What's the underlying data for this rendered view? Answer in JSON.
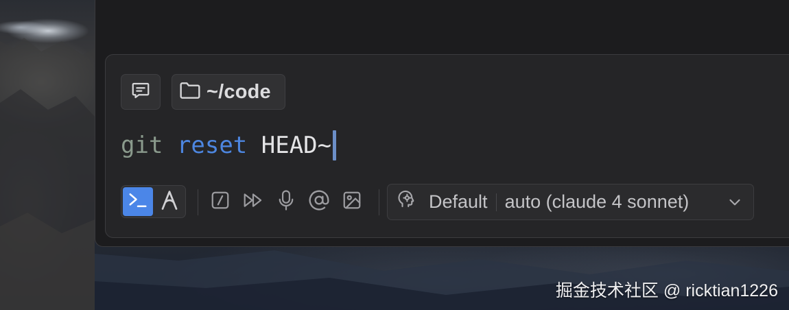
{
  "colors": {
    "accent": "#4b86e8",
    "panel_bg": "#252527",
    "window_bg": "#1c1c1e",
    "command_color": "#8a9a8c",
    "subcommand_color": "#4d86e0",
    "argument_color": "#e4e4e6",
    "cursor_color": "#6c8fc8"
  },
  "context_chips": {
    "chat_icon": "chat-bubble-icon",
    "directory_icon": "folder-icon",
    "directory_label": "~/code"
  },
  "command_input": {
    "command": "git",
    "subcommand": "reset",
    "argument": "HEAD~"
  },
  "toolbar": {
    "mode_toggle": [
      {
        "icon": "terminal-prompt-icon",
        "active": true
      },
      {
        "icon": "agent-a-icon",
        "active": false
      }
    ],
    "tools": [
      {
        "icon": "slash-command-icon"
      },
      {
        "icon": "fast-forward-icon"
      },
      {
        "icon": "microphone-icon"
      },
      {
        "icon": "at-mention-icon"
      },
      {
        "icon": "image-attach-icon"
      }
    ],
    "model_select": {
      "icon": "head-gear-icon",
      "profile": "Default",
      "model": "auto (claude 4 sonnet)",
      "chevron_icon": "chevron-down-icon"
    }
  },
  "watermark": {
    "text": "掘金技术社区 @ ricktian1226"
  }
}
